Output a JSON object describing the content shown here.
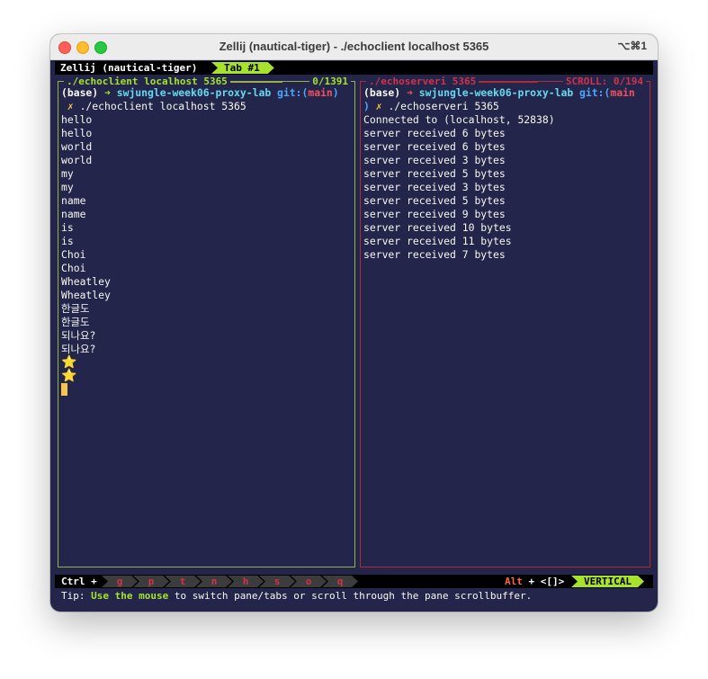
{
  "window": {
    "title": "Zellij (nautical-tiger) - ./echoclient localhost 5365",
    "shortcut": "⌥⌘1"
  },
  "tabbar": {
    "session": "Zellij (nautical-tiger)",
    "tab": "Tab #1"
  },
  "left_pane": {
    "title": "./echoclient localhost 5365",
    "scroll": "0/1391",
    "prompt": {
      "env": "(base)",
      "arrow": "➜",
      "dir": "swjungle-week06-proxy-lab",
      "git_open": "git:(",
      "branch": "main",
      "git_close": ")"
    },
    "command_mark": "✗",
    "command": "./echoclient localhost 5365",
    "output": [
      "hello",
      "hello",
      "world",
      "world",
      "my",
      "my",
      "name",
      "name",
      "is",
      "is",
      "Choi",
      "Choi",
      "Wheatley",
      "Wheatley",
      "한글도",
      "한글도",
      "되나요?",
      "되나요?"
    ],
    "emoji": [
      "⭐",
      "⭐"
    ]
  },
  "right_pane": {
    "title": "./echoserveri 5365",
    "scroll": "SCROLL:  0/194",
    "prompt": {
      "env": "(base)",
      "arrow": "➜",
      "dir": "swjungle-week06-proxy-lab",
      "git_open": "git:(",
      "branch": "main",
      "git_close": ")"
    },
    "command_mark": "✗",
    "command": "./echoserveri 5365",
    "output": [
      "Connected to (localhost, 52838)",
      "server received 6 bytes",
      "server received 6 bytes",
      "server received 3 bytes",
      "server received 5 bytes",
      "server received 3 bytes",
      "server received 5 bytes",
      "server received 9 bytes",
      "server received 10 bytes",
      "server received 11 bytes",
      "server received 7 bytes"
    ]
  },
  "statusbar": {
    "ctrl": "Ctrl +",
    "keys": [
      "g",
      "p",
      "t",
      "n",
      "h",
      "s",
      "o",
      "q"
    ],
    "alt_key": "Alt",
    "alt_rest": " + <[]>",
    "mode": "VERTICAL"
  },
  "tip": {
    "prefix": "Tip: ",
    "highlight": "Use the mouse",
    "rest": " to switch pane/tabs or scroll through the pane scrollbuffer."
  },
  "colors": {
    "background": "#23264a",
    "accent_green": "#a6e22e",
    "accent_red": "#d2324a"
  }
}
